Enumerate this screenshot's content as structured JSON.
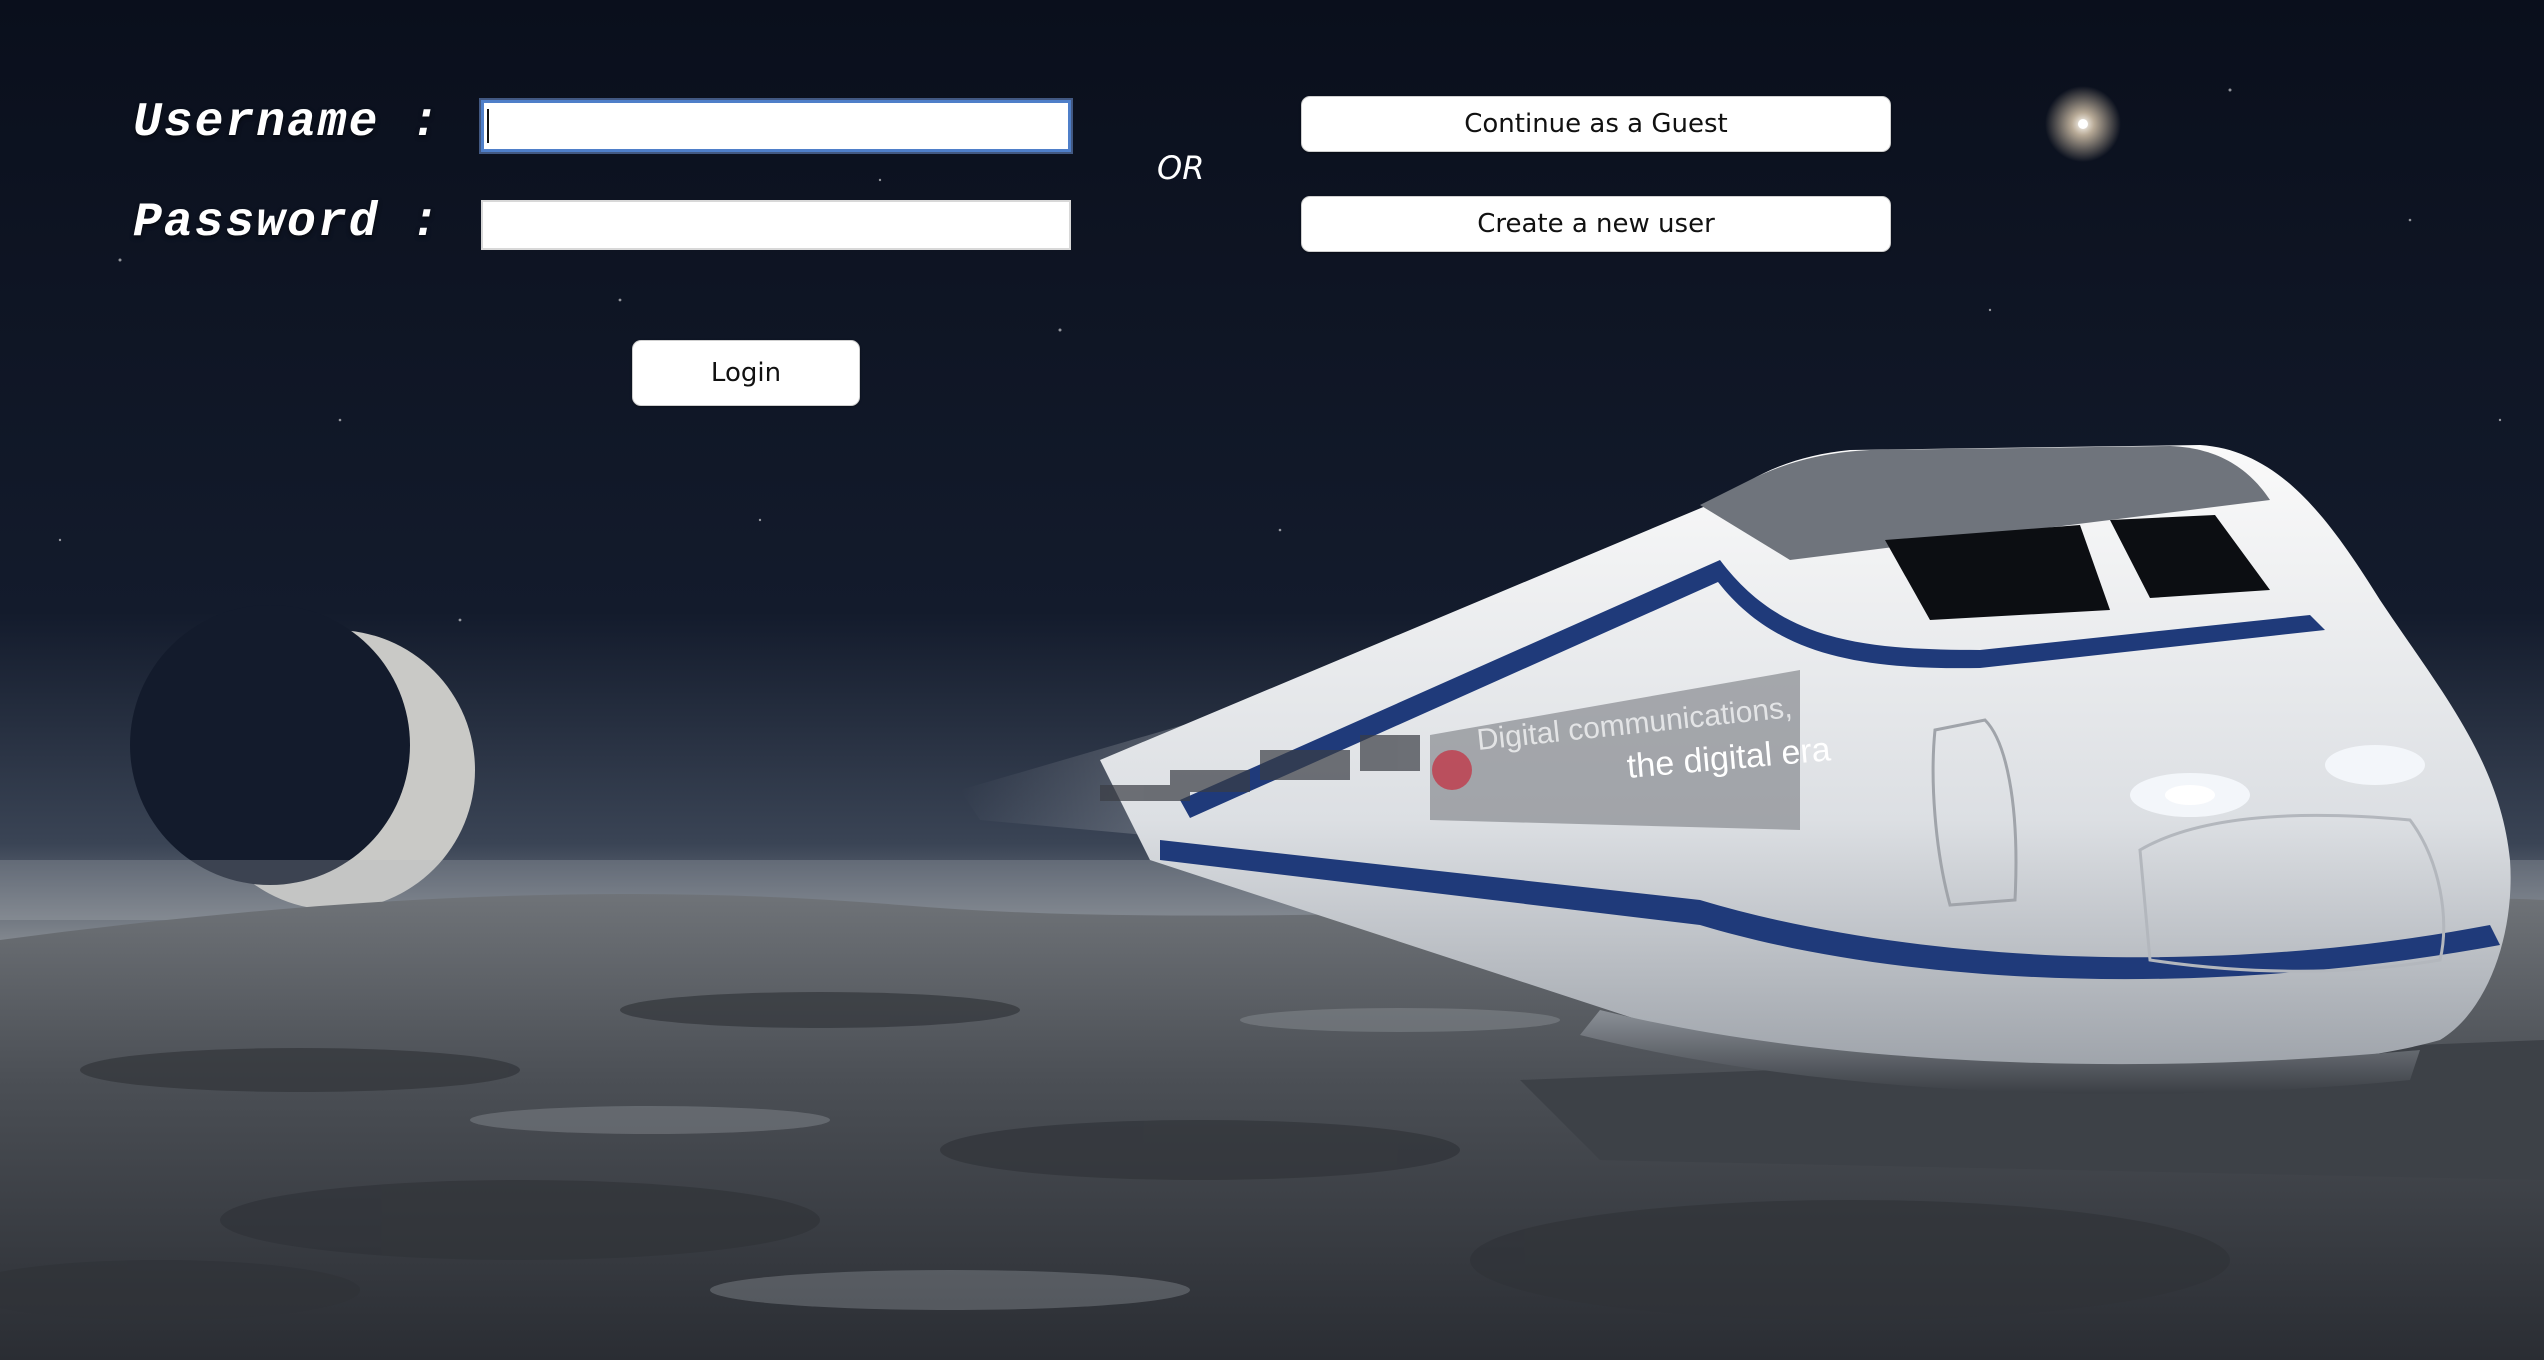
{
  "form": {
    "username_label": "Username :",
    "password_label": "Password :",
    "username_value": "",
    "password_value": "",
    "login_label": "Login",
    "or_text": "OR"
  },
  "actions": {
    "guest_label": "Continue as a Guest",
    "new_user_label": "Create a new user"
  },
  "background": {
    "train_ad_line1": "Digital communications,",
    "train_ad_line2": "the digital era"
  },
  "colors": {
    "sky": "#0c1220",
    "train_stripe": "#1f3a7a",
    "input_focus": "#4f7fc9"
  }
}
